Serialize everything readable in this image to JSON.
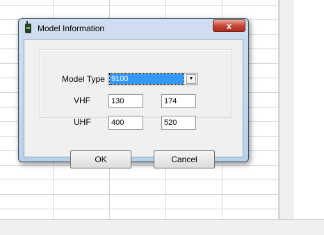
{
  "dialog": {
    "title": "Model Information",
    "close_glyph": "x",
    "fields": {
      "model_type_label": "Model Type",
      "model_type_value": "9100",
      "vhf_label": "VHF",
      "vhf_low": "130",
      "vhf_high": "174",
      "uhf_label": "UHF",
      "uhf_low": "400",
      "uhf_high": "520"
    },
    "buttons": {
      "ok": "OK",
      "cancel": "Cancel"
    }
  },
  "icons": {
    "app": "radio-icon",
    "dropdown": "chevron-down-icon"
  },
  "colors": {
    "selection": "#3399ff",
    "close_button": "#c7473a",
    "titlebar": "#cfdff0"
  }
}
